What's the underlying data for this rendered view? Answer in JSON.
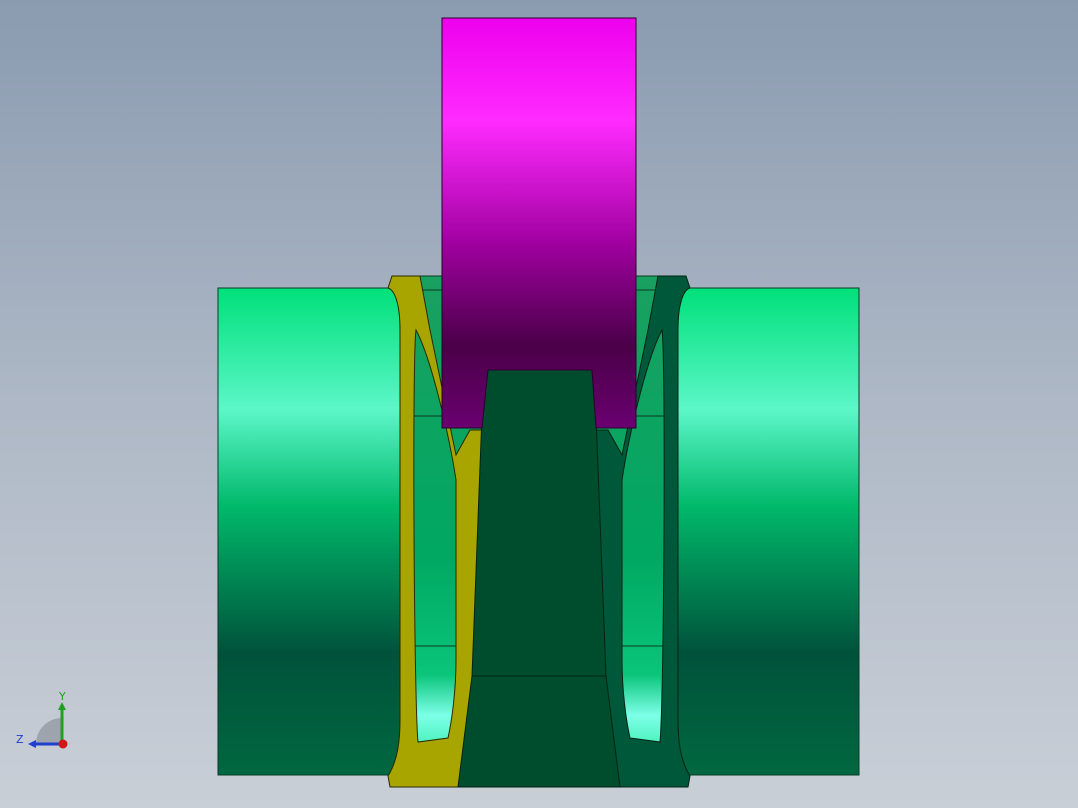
{
  "viewport": {
    "background_top": "#8a9bb0",
    "background_bottom": "#c9cfd7"
  },
  "model": {
    "parts": [
      {
        "name": "left-cylinder",
        "color": "#00e07a"
      },
      {
        "name": "right-cylinder",
        "color": "#00e07a"
      },
      {
        "name": "shaft-block",
        "color": "#ff00ff"
      },
      {
        "name": "left-spring-profile",
        "color": "#a8a400"
      },
      {
        "name": "right-spring-profile",
        "color": "#00583a"
      },
      {
        "name": "center-hub",
        "color": "#004d2e"
      }
    ]
  },
  "triad": {
    "y_label": "Y",
    "z_label": "Z",
    "y_color": "#1fa11f",
    "z_color": "#1f3fcf",
    "x_color": "#d01818",
    "icons": [
      "axis-triad-icon"
    ]
  }
}
